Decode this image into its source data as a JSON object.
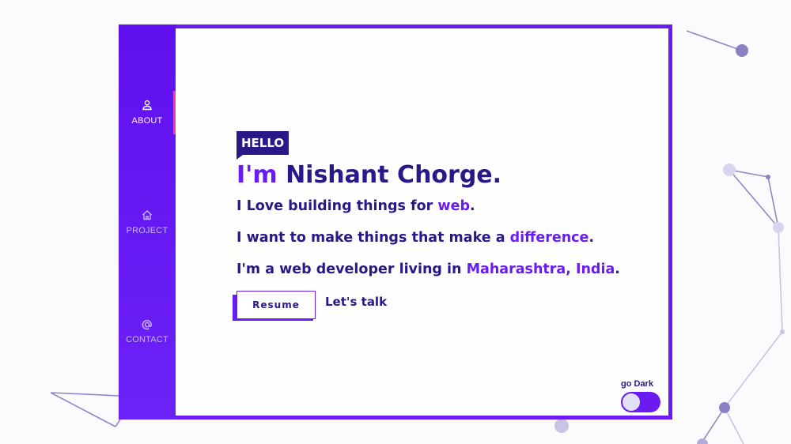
{
  "nav": {
    "items": [
      {
        "label": "ABOUT",
        "icon": "user-icon",
        "active": true
      },
      {
        "label": "PROJECT",
        "icon": "home-icon",
        "active": false
      },
      {
        "label": "CONTACT",
        "icon": "at-icon",
        "active": false
      }
    ]
  },
  "hero": {
    "badge": "HELLO",
    "intro": "I'm",
    "name": "Nishant Chorge.",
    "line1_prefix": "I Love building things for",
    "line1_accent": "web",
    "line1_suffix": ".",
    "line2_prefix": "I want to make things that make a",
    "line2_accent": "difference",
    "line2_suffix": ".",
    "line3_prefix": "I'm a web developer living in",
    "line3_accent": "Maharashtra, India",
    "line3_suffix": "."
  },
  "actions": {
    "resume_label": "Resume",
    "talk_label": "Let's talk"
  },
  "theme_toggle": {
    "label": "go Dark",
    "dark_mode_on": false
  },
  "colors": {
    "accent": "#6a1bf2",
    "text_dark": "#2a1788",
    "sidebar_active_marker": "#f0447a",
    "network_lines": "#8a82c4"
  }
}
